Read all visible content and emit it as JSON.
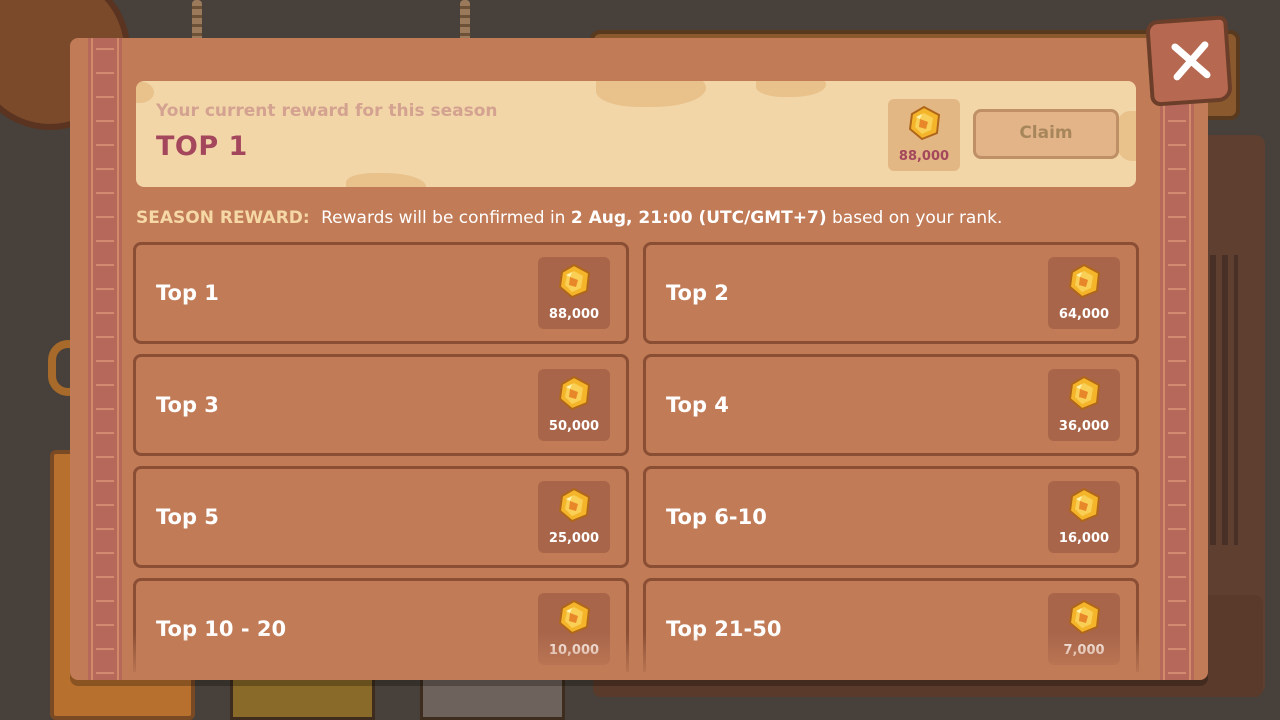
{
  "current_reward": {
    "label": "Your current reward for this season",
    "rank": "TOP 1",
    "amount": "88,000",
    "claim_label": "Claim",
    "claim_enabled": false
  },
  "season": {
    "lead": "SEASON REWARD:",
    "text_before": "Rewards will be confirmed in",
    "date": "2 Aug, 21:00 (UTC/GMT+7)",
    "text_after": "based on your rank."
  },
  "rewards": [
    {
      "label": "Top 1",
      "amount": "88,000"
    },
    {
      "label": "Top 2",
      "amount": "64,000"
    },
    {
      "label": "Top 3",
      "amount": "50,000"
    },
    {
      "label": "Top 4",
      "amount": "36,000"
    },
    {
      "label": "Top 5",
      "amount": "25,000"
    },
    {
      "label": "Top 6-10",
      "amount": "16,000"
    },
    {
      "label": "Top 10 - 20",
      "amount": "10,000"
    },
    {
      "label": "Top 21-50",
      "amount": "7,000"
    }
  ],
  "icons": {
    "gem": "gem-icon",
    "close": "close-icon"
  },
  "colors": {
    "panel": "#c17b57",
    "banner": "#f2d6a8",
    "rank_text": "#a4475c",
    "gem_gold": "#f5b52a"
  }
}
